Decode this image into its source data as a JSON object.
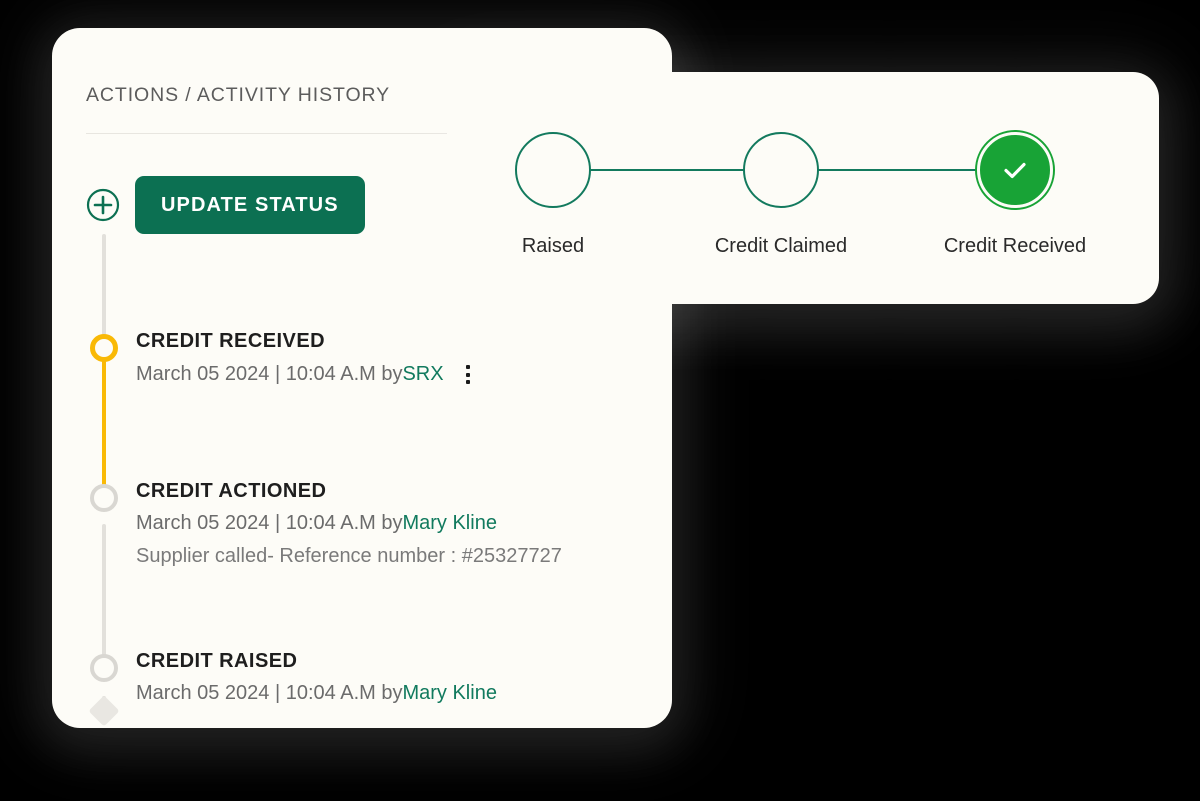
{
  "card": {
    "header": "ACTIONS / ACTIVITY HISTORY",
    "update_button": "UPDATE STATUS",
    "add_icon": "plus-circle-icon",
    "menu_icon": "kebab-menu-icon"
  },
  "timeline": {
    "entries": [
      {
        "title": "CREDIT RECEIVED",
        "date": "March 05 2024 | 10:04 A.M by ",
        "actor": "SRX",
        "note": "",
        "marker": "amber",
        "has_menu": true
      },
      {
        "title": "CREDIT ACTIONED",
        "date": "March 05 2024 | 10:04 A.M by ",
        "actor": "Mary Kline",
        "note": "Supplier called- Reference number : #25327727",
        "marker": "grey",
        "has_menu": false
      },
      {
        "title": "CREDIT RAISED",
        "date": "March 05 2024 | 10:04 A.M by ",
        "actor": "Mary Kline",
        "note": "",
        "marker": "grey",
        "has_menu": false
      }
    ]
  },
  "stepper": {
    "steps": [
      {
        "label": "Raised",
        "state": "open"
      },
      {
        "label": "Credit Claimed",
        "state": "open"
      },
      {
        "label": "Credit Received",
        "state": "done"
      }
    ],
    "check_icon": "check-icon"
  },
  "colors": {
    "page_background": "#000000",
    "card_background": "#FDFCF7",
    "brand_green": "#0C7052",
    "accent_green": "#18A336",
    "link_green": "#117A5E",
    "amber": "#F9B906",
    "rail_grey": "#E2E0DB"
  }
}
